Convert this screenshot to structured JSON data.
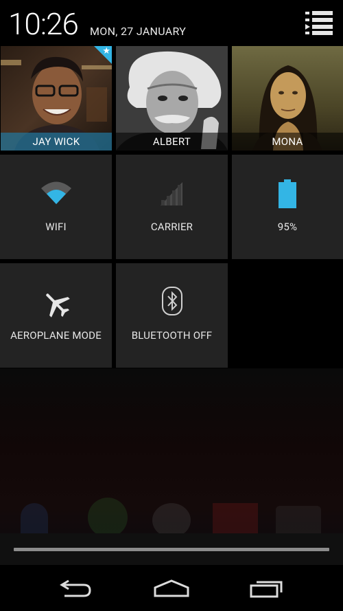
{
  "status": {
    "time": "10:26",
    "date": "MON, 27 JANUARY"
  },
  "contacts": [
    {
      "name": "JAY WICK",
      "is_me": true
    },
    {
      "name": "ALBERT",
      "is_me": false
    },
    {
      "name": "MONA",
      "is_me": false
    }
  ],
  "quick_settings": {
    "wifi": {
      "label": "WIFI",
      "icon": "wifi-icon"
    },
    "carrier": {
      "label": "CARRIER",
      "icon": "signal-icon"
    },
    "battery": {
      "label": "95%",
      "icon": "battery-icon",
      "level_percent": 95
    },
    "airplane": {
      "label": "AEROPLANE MODE",
      "icon": "airplane-icon"
    },
    "bluetooth": {
      "label": "BLUETOOTH OFF",
      "icon": "bluetooth-icon"
    }
  },
  "icons": {
    "settings": "settings-list-icon",
    "back": "back-icon",
    "home": "home-icon",
    "recents": "recent-apps-icon"
  },
  "colors": {
    "accent": "#33b5e5",
    "tile_bg": "#232323",
    "battery": "#33b5e5"
  }
}
